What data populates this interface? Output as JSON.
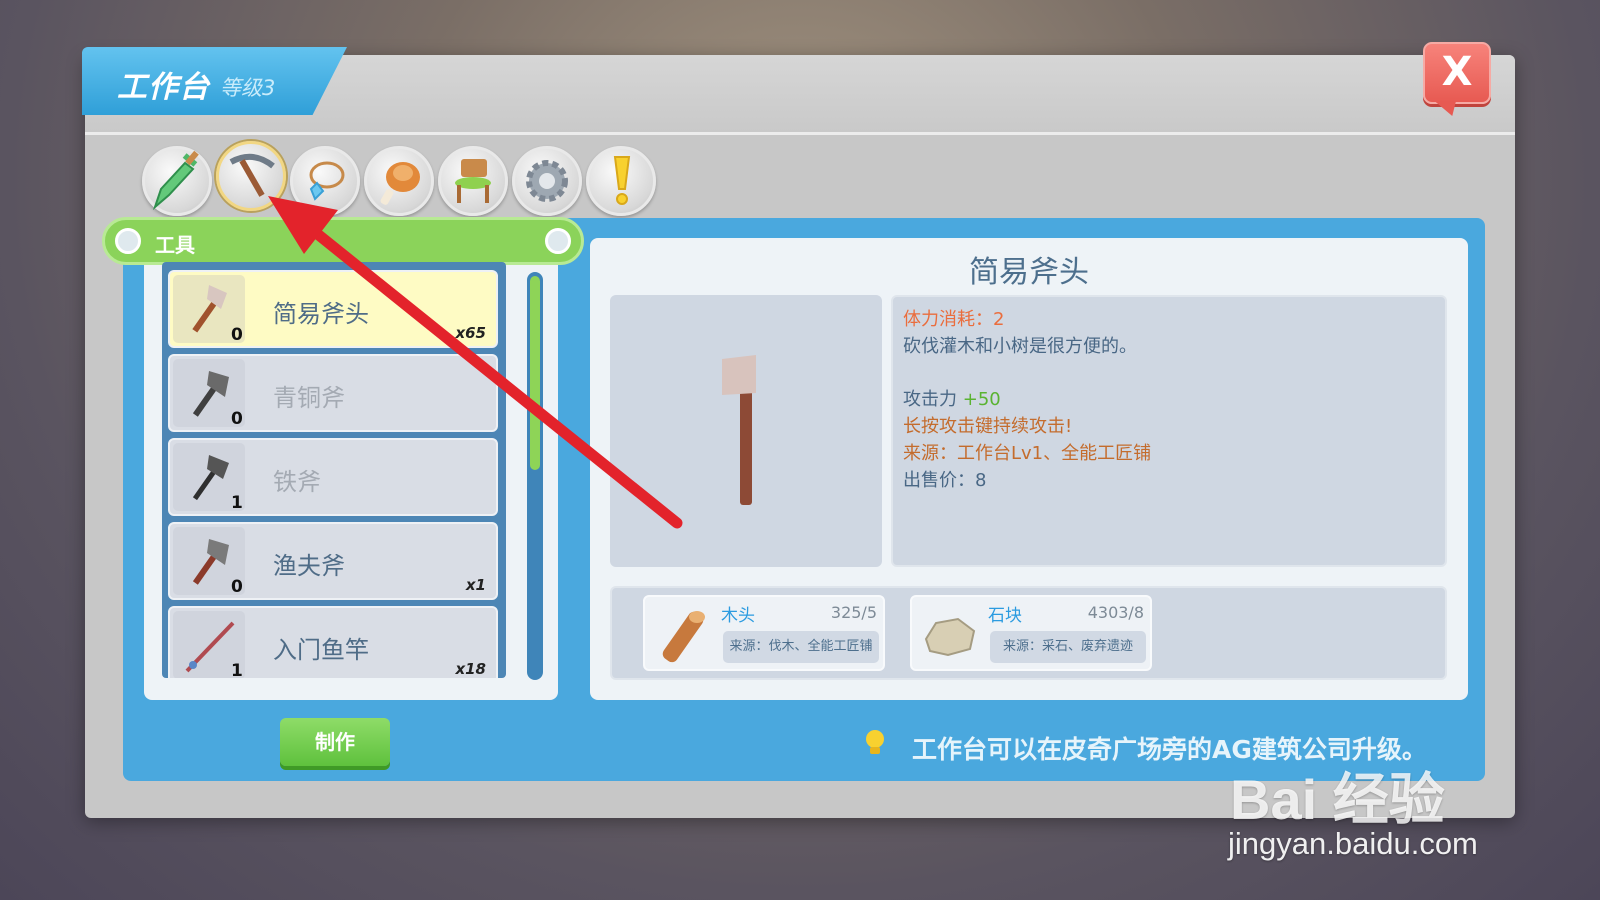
{
  "window": {
    "title": "工作台",
    "level": "等级3",
    "close_label": "X"
  },
  "categories": [
    {
      "name": "sword",
      "icon": "sword-icon"
    },
    {
      "name": "pickaxe",
      "icon": "pickaxe-icon",
      "active": true
    },
    {
      "name": "necklace",
      "icon": "necklace-icon"
    },
    {
      "name": "food",
      "icon": "meat-icon"
    },
    {
      "name": "furniture",
      "icon": "chair-icon"
    },
    {
      "name": "gear",
      "icon": "gear-icon"
    },
    {
      "name": "quest",
      "icon": "exclamation-icon"
    }
  ],
  "section": {
    "label": "工具"
  },
  "items": [
    {
      "name": "简易斧头",
      "count": "0",
      "owned": "x65",
      "selected": true
    },
    {
      "name": "青铜斧",
      "count": "0",
      "owned": "",
      "locked": true
    },
    {
      "name": "铁斧",
      "count": "1",
      "owned": "",
      "locked": true
    },
    {
      "name": "渔夫斧",
      "count": "0",
      "owned": "x1"
    },
    {
      "name": "入门鱼竿",
      "count": "1",
      "owned": "x18"
    }
  ],
  "craft_button": "制作",
  "detail": {
    "title": "简易斧头",
    "stamina_label": "体力消耗：",
    "stamina_value": "2",
    "description": "砍伐灌木和小树是很方便的。",
    "attack_label": "攻击力",
    "attack_value": "+50",
    "hold_hint": "长按攻击键持续攻击!",
    "source": "来源：工作台Lv1、全能工匠铺",
    "price_label": "出售价：",
    "price_value": "8"
  },
  "materials": [
    {
      "name": "木头",
      "qty": "325/5",
      "source": "来源：伐木、全能工匠铺",
      "icon": "wood-log-icon"
    },
    {
      "name": "石块",
      "qty": "4303/8",
      "source": "来源：采石、废弃遗迹",
      "icon": "stone-icon"
    }
  ],
  "tip": "工作台可以在皮奇广场旁的AG建筑公司升级。",
  "watermark": {
    "logo": "Bai 经验",
    "url": "jingyan.baidu.com"
  },
  "colors": {
    "panel_blue": "#4aa8de",
    "section_green": "#8bd35a",
    "close_red": "#e75a52",
    "arrow_red": "#e3232b"
  }
}
